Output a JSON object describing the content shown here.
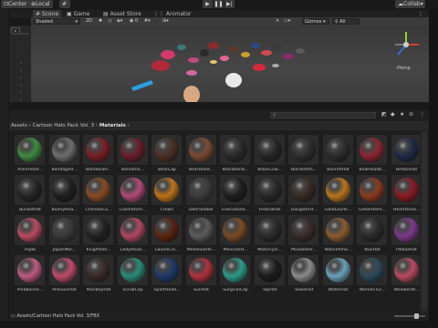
{
  "toolbar": {
    "pivot_label": "Center",
    "space_label": "Local",
    "collab_label": "Collab"
  },
  "tabs": [
    {
      "label": "Scene",
      "icon": "hash-icon",
      "active": true
    },
    {
      "label": "Game",
      "icon": "gamepad-icon"
    },
    {
      "label": "Asset Store",
      "icon": "store-icon"
    },
    {
      "label": "Animator",
      "icon": "animator-icon"
    }
  ],
  "scene_bar": {
    "shading_mode": "Shaded",
    "mode_2d": "2D",
    "gizmos_label": "Gizmos",
    "search_prefix": "All"
  },
  "viewport": {
    "persp_label": "Persp"
  },
  "project": {
    "breadcrumb": [
      "Assets",
      "Cartoon Hats Pack Vol. 3",
      "Materials"
    ],
    "status_path": "Assets/Cartoon Hats Pack Vol. 3/FBX",
    "items": [
      {
        "name": "AlienHead...",
        "color": "#3f8a3f"
      },
      {
        "name": "BandageH...",
        "color": "#6e6e6e"
      },
      {
        "name": "BandanaH...",
        "color": "#7a1f24"
      },
      {
        "name": "Bandana...",
        "color": "#6a1e2a"
      },
      {
        "name": "BearCap",
        "color": "#4a3022"
      },
      {
        "name": "BearHead...",
        "color": "#7a4a34"
      },
      {
        "name": "BlackBand...",
        "color": "#2a2a2a"
      },
      {
        "name": "BlackCow...",
        "color": "#262626"
      },
      {
        "name": "BlackParts...",
        "color": "#2e2e2e"
      },
      {
        "name": "BonnetHat",
        "color": "#2c2c2c"
      },
      {
        "name": "BowHeadb...",
        "color": "#8a2530"
      },
      {
        "name": "BretonHat",
        "color": "#1e2a45"
      },
      {
        "name": "BucketHat",
        "color": "#252525"
      },
      {
        "name": "BunnyHea...",
        "color": "#1f1f1f"
      },
      {
        "name": "ChineseCo...",
        "color": "#8a4a22"
      },
      {
        "name": "CosmeticH...",
        "color": "#b04a78"
      },
      {
        "name": "Crown",
        "color": "#c07318"
      },
      {
        "name": "DeerStalker",
        "color": "#3c3c3c"
      },
      {
        "name": "Executione...",
        "color": "#1e1e1e"
      },
      {
        "name": "FedoraHat",
        "color": "#282828"
      },
      {
        "name": "GangsterH...",
        "color": "#3a2a24"
      },
      {
        "name": "GoldLaurel...",
        "color": "#b8741c"
      },
      {
        "name": "GreekHelm...",
        "color": "#8a3a1e"
      },
      {
        "name": "HeartHead...",
        "color": "#8a1a24"
      },
      {
        "name": "Hijab",
        "color": "#b84a60"
      },
      {
        "name": "JapanMor...",
        "color": "#3a3a3a"
      },
      {
        "name": "KnightHel...",
        "color": "#222222"
      },
      {
        "name": "LadyHead...",
        "color": "#b04860"
      },
      {
        "name": "LaurelCro...",
        "color": "#5a2410"
      },
      {
        "name": "MedievalHe...",
        "color": "#5a5a5a"
      },
      {
        "name": "MexicanH...",
        "color": "#7a4a22"
      },
      {
        "name": "Motorcycl...",
        "color": "#2a2a2a"
      },
      {
        "name": "Musketeer...",
        "color": "#3a2a2a"
      },
      {
        "name": "NativeAme...",
        "color": "#8a5a30"
      },
      {
        "name": "NunHat",
        "color": "#2a2a2a"
      },
      {
        "name": "PillboxHat",
        "color": "#7a3a8a"
      },
      {
        "name": "PinkBonne...",
        "color": "#c05a80"
      },
      {
        "name": "PinkSunHat",
        "color": "#c04a6a"
      },
      {
        "name": "PoorBoyHat",
        "color": "#3a2a28"
      },
      {
        "name": "ScrubCap",
        "color": "#2a8a7a"
      },
      {
        "name": "SportHead...",
        "color": "#1e3a6a"
      },
      {
        "name": "SunHat",
        "color": "#b03040"
      },
      {
        "name": "SurgicalCap",
        "color": "#2a9a8a"
      },
      {
        "name": "TopHat",
        "color": "#1c1c1c"
      },
      {
        "name": "TowelHat",
        "color": "#8a8a8a"
      },
      {
        "name": "WaterHat",
        "color": "#6aa0b8"
      },
      {
        "name": "WomenTur...",
        "color": "#2a4a5a"
      },
      {
        "name": "WoolBeret...",
        "color": "#b84a60"
      }
    ]
  }
}
